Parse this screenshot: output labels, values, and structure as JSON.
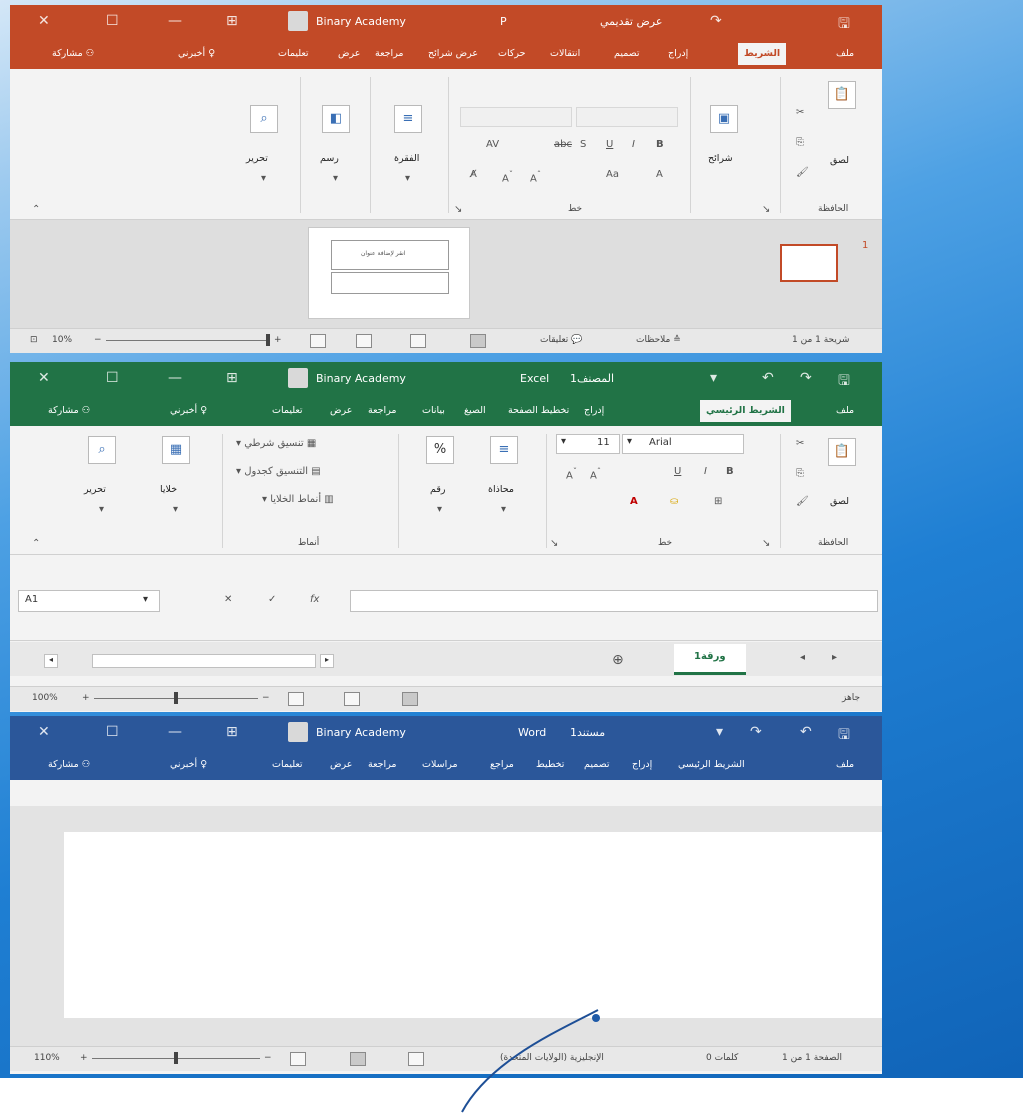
{
  "colors": {
    "powerpoint": "#c24a27",
    "excel": "#217346",
    "word": "#2b579a",
    "desktop": "#1f7fd3"
  },
  "powerpoint": {
    "title": "Binary Academy",
    "doc_title": "عرض تقديمي",
    "app": "P",
    "tabs": [
      "ملف",
      "الشريط",
      "إدراج",
      "تصميم",
      "انتقالات",
      "حركات",
      "عرض شرائح",
      "مراجعة",
      "عرض",
      "تعليمات"
    ],
    "tell_me": "أخبرني",
    "share": "مشاركة",
    "groups": {
      "clipboard": "الحافظة",
      "font": "خط"
    },
    "buttons": {
      "paste": "لصق",
      "slides": "شرائح",
      "paragraph": "الفقرة",
      "draw": "رسم",
      "edit": "تحرير"
    },
    "slide_placeholder": "انقر لإضافة عنوان",
    "slide_number": "1",
    "status": {
      "slide_count": "شريحة 1 من 1",
      "notes": "ملاحظات",
      "comments": "تعليقات",
      "zoom": "10%"
    }
  },
  "excel": {
    "title": "Binary Academy",
    "app": "Excel",
    "doc_title": "المصنف1",
    "tabs": [
      "ملف",
      "الشريط الرئيسي",
      "إدراج",
      "تخطيط الصفحة",
      "الصيغ",
      "بيانات",
      "مراجعة",
      "عرض",
      "تعليمات"
    ],
    "tell_me": "أخبرني",
    "share": "مشاركة",
    "groups": {
      "clipboard": "الحافظة",
      "font": "خط",
      "styles": "أنماط"
    },
    "font_name": "Arial",
    "font_size": "11",
    "buttons": {
      "paste": "لصق",
      "alignment": "محاذاة",
      "number": "رقم",
      "cells": "خلايا",
      "edit": "تحرير"
    },
    "styles": [
      "تنسيق شرطي",
      "التنسيق كجدول",
      "أنماط الخلايا"
    ],
    "name_box": "A1",
    "sheet_tab": "ورقة1",
    "status": {
      "ready": "جاهز",
      "zoom": "100%"
    }
  },
  "word": {
    "title": "Binary Academy",
    "app": "Word",
    "doc_title": "مستند1",
    "tabs": [
      "ملف",
      "الشريط الرئيسي",
      "إدراج",
      "تصميم",
      "تخطيط",
      "مراجع",
      "مراسلات",
      "مراجعة",
      "عرض",
      "تعليمات"
    ],
    "tell_me": "أخبرني",
    "share": "مشاركة",
    "status": {
      "page": "الصفحة 1 من 1",
      "words": "0 كلمات",
      "language": "الإنجليزية (الولايات المتحدة)",
      "zoom": "110%"
    }
  }
}
